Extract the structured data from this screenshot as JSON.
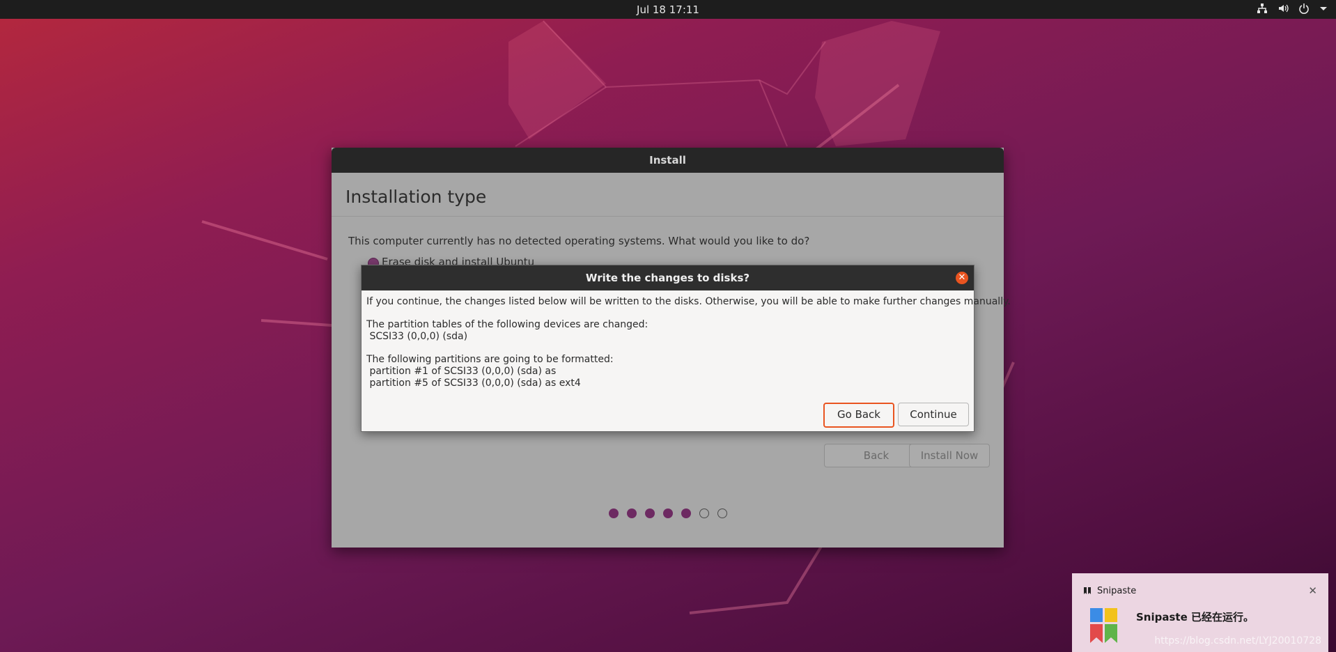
{
  "topbar": {
    "clock": "Jul 18  17:11",
    "icons": [
      "network-icon",
      "volume-icon",
      "power-icon",
      "menu-arrow-icon"
    ]
  },
  "installer": {
    "window_title": "Install",
    "heading": "Installation type",
    "question": "This computer currently has no detected operating systems. What would you like to do?",
    "option_selected": "Erase disk and install Ubuntu",
    "back_label": "Back",
    "install_now_label": "Install Now",
    "progress": {
      "total": 7,
      "completed": 5
    }
  },
  "dialog": {
    "title": "Write the changes to disks?",
    "intro": "If you continue, the changes listed below will be written to the disks. Otherwise, you will be able to make further changes manually.",
    "tables_header": "The partition tables of the following devices are changed:",
    "tables_items": [
      " SCSI33 (0,0,0) (sda)"
    ],
    "format_header": "The following partitions are going to be formatted:",
    "format_items": [
      " partition #1 of SCSI33 (0,0,0) (sda) as",
      " partition #5 of SCSI33 (0,0,0) (sda) as ext4"
    ],
    "go_back_label": "Go Back",
    "continue_label": "Continue"
  },
  "notification": {
    "app_name": "Snipaste",
    "message": "Snipaste 已经在运行。"
  },
  "watermark": "https://blog.csdn.net/LYJ20010728",
  "colors": {
    "accent": "#e95420",
    "progress_dot": "#6d2a62",
    "topbar": "#1d1d1d"
  }
}
